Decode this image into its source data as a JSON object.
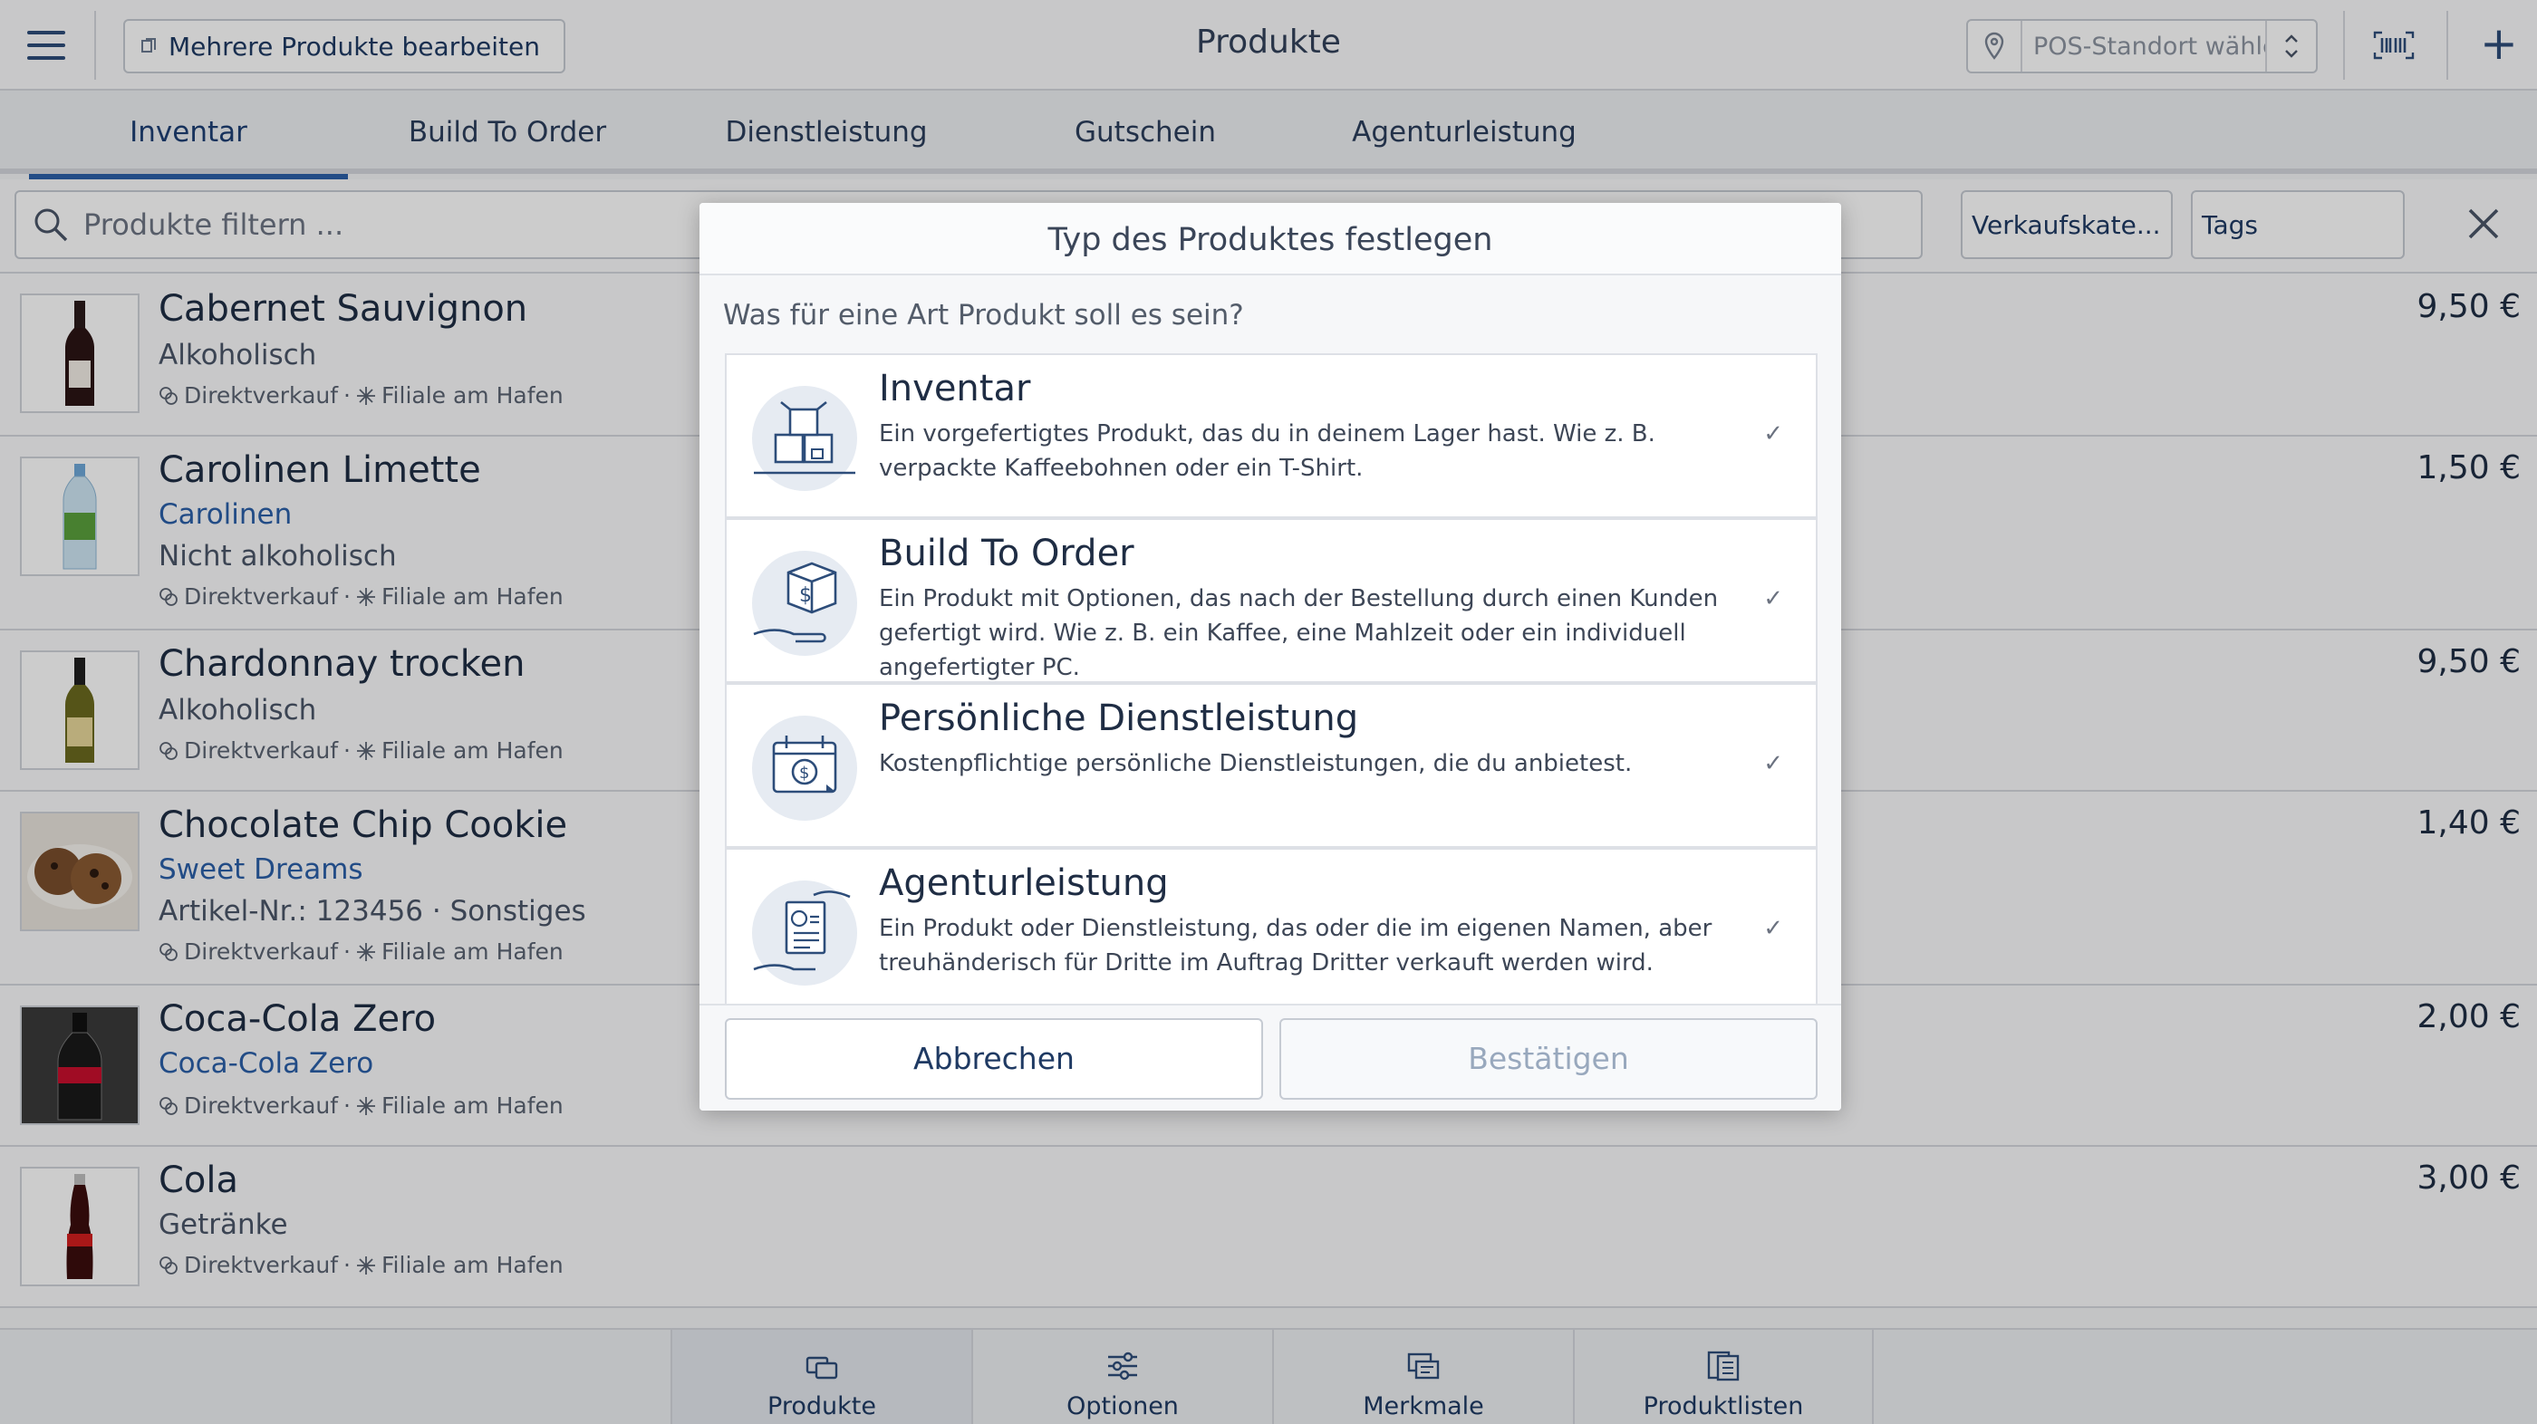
{
  "header": {
    "bulk_edit_label": "Mehrere Produkte bearbeiten",
    "title": "Produkte",
    "pos_placeholder": "POS-Standort wählen..."
  },
  "tabs": [
    {
      "label": "Inventar",
      "active": true
    },
    {
      "label": "Build To Order",
      "active": false
    },
    {
      "label": "Dienstleistung",
      "active": false
    },
    {
      "label": "Gutschein",
      "active": false
    },
    {
      "label": "Agenturleistung",
      "active": false
    }
  ],
  "filter": {
    "search_placeholder": "Produkte filtern ...",
    "category_chip": "Verkaufskate...",
    "tags_chip": "Tags"
  },
  "products": [
    {
      "name": "Cabernet Sauvignon",
      "line1": "Alkoholisch",
      "channel": "Direktverkauf",
      "store": "Filiale am Hafen",
      "price": "9,50 €"
    },
    {
      "name": "Carolinen Limette",
      "brand": "Carolinen",
      "line1": "Nicht alkoholisch",
      "channel": "Direktverkauf",
      "store": "Filiale am Hafen",
      "price": "1,50 €"
    },
    {
      "name": "Chardonnay trocken",
      "line1": "Alkoholisch",
      "channel": "Direktverkauf",
      "store": "Filiale am Hafen",
      "price": "9,50 €"
    },
    {
      "name": "Chocolate Chip Cookie",
      "brand": "Sweet Dreams",
      "line1": "Artikel-Nr.: 123456 · Sonstiges",
      "channel": "Direktverkauf",
      "store": "Filiale am Hafen",
      "price": "1,40 €"
    },
    {
      "name": "Coca-Cola Zero",
      "brand": "Coca-Cola Zero",
      "channel": "Direktverkauf",
      "store": "Filiale am Hafen",
      "price": "2,00 €"
    },
    {
      "name": "Cola",
      "line1": "Getränke",
      "channel": "Direktverkauf",
      "store": "Filiale am Hafen",
      "price": "3,00 €"
    }
  ],
  "meta_separator": "·",
  "bottom_nav": [
    {
      "label": "Produkte",
      "active": true
    },
    {
      "label": "Optionen",
      "active": false
    },
    {
      "label": "Merkmale",
      "active": false
    },
    {
      "label": "Produktlisten",
      "active": false
    }
  ],
  "modal": {
    "title": "Typ des Produktes festlegen",
    "question": "Was für eine Art Produkt soll es sein?",
    "options": [
      {
        "title": "Inventar",
        "description": "Ein vorgefertigtes Produkt, das du in deinem Lager hast. Wie z. B. verpackte Kaffeebohnen oder ein T-Shirt."
      },
      {
        "title": "Build To Order",
        "description": "Ein Produkt mit Optionen, das nach der Bestellung durch einen Kunden gefertigt wird. Wie z. B. ein Kaffee, eine Mahlzeit oder ein individuell angefertigter PC."
      },
      {
        "title": "Persönliche Dienstleistung",
        "description": "Kostenpflichtige persönliche Dienstleistungen, die du anbietest."
      },
      {
        "title": "Agenturleistung",
        "description": "Ein Produkt oder Dienstleistung, das oder die im eigenen Namen, aber treuhänderisch für Dritte im Auftrag Dritter verkauft werden wird."
      }
    ],
    "check_glyph": "✓",
    "cancel_label": "Abbrechen",
    "confirm_label": "Bestätigen"
  },
  "colors": {
    "accent": "#2b5fa8",
    "text_dark": "#1f2d44",
    "icon_blue": "#2d4d7a",
    "icon_bg": "#e6ebf2"
  }
}
